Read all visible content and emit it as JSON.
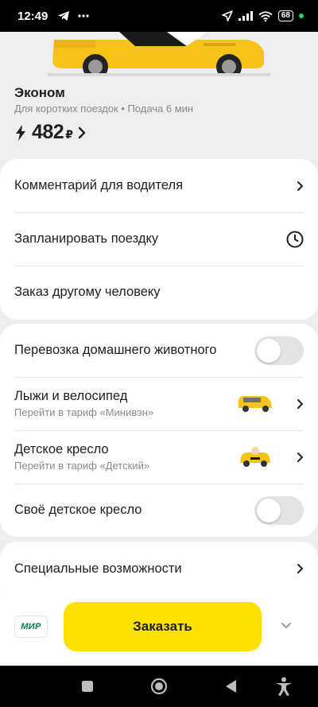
{
  "status_bar": {
    "time": "12:49",
    "battery": "68"
  },
  "tariff": {
    "name": "Эконом",
    "description": "Для коротких поездок • Подача 6 мин",
    "price": "482",
    "currency": "₽"
  },
  "options": {
    "driver_comment": "Комментарий для водителя",
    "schedule_trip": "Запланировать поездку",
    "order_for_other": "Заказ другому человеку",
    "pet_transport": "Перевозка домашнего животного",
    "skis_bike": {
      "label": "Лыжи и велосипед",
      "sub": "Перейти в тариф «Минивэн»"
    },
    "child_seat": {
      "label": "Детское кресло",
      "sub": "Перейти в тариф «Детский»"
    },
    "own_child_seat": "Своё детское кресло",
    "accessibility": "Специальные возможности",
    "toggles": {
      "pet_transport": false,
      "own_child_seat": false
    }
  },
  "bottom": {
    "payment": "МИР",
    "order_label": "Заказать"
  },
  "colors": {
    "accent": "#fce000",
    "background": "#eeeeee",
    "card": "#ffffff"
  }
}
